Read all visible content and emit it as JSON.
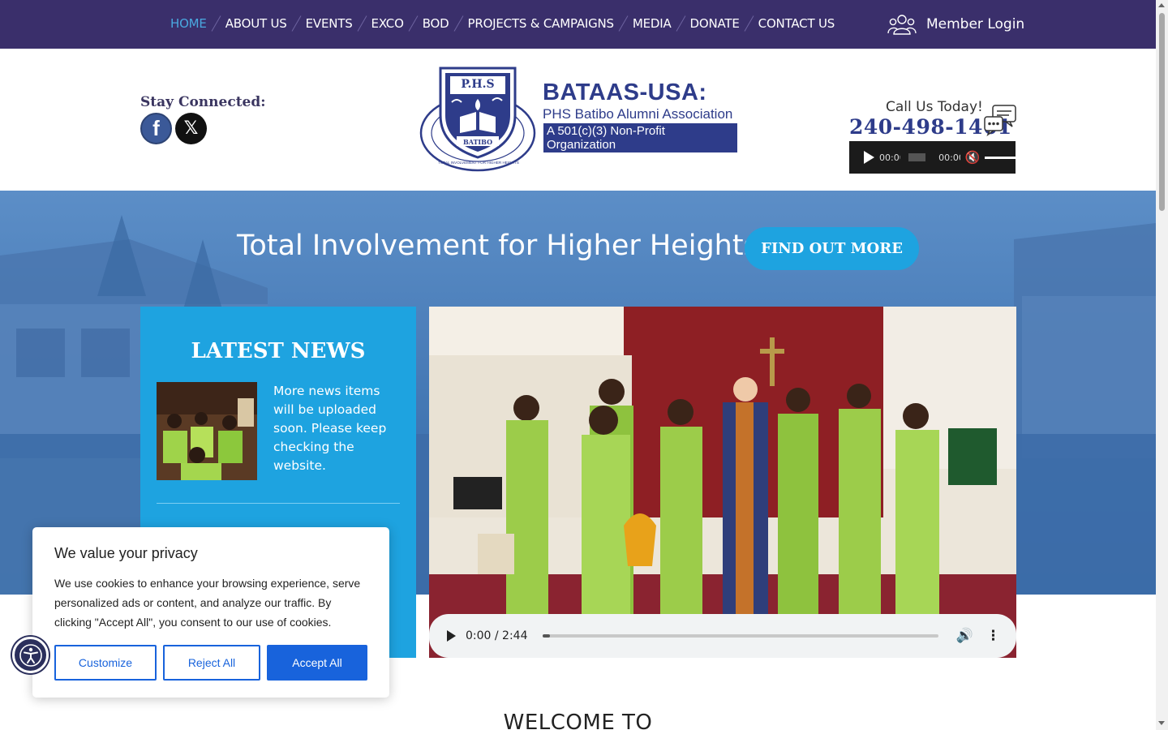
{
  "nav": {
    "items": [
      {
        "label": "HOME",
        "active": true
      },
      {
        "label": "ABOUT US"
      },
      {
        "label": "EVENTS"
      },
      {
        "label": "EXCO"
      },
      {
        "label": "BOD"
      },
      {
        "label": "PROJECTS & CAMPAIGNS"
      },
      {
        "label": "MEDIA"
      },
      {
        "label": "DONATE"
      },
      {
        "label": "CONTACT US"
      }
    ],
    "member_login": "Member Login",
    "member_icon": "users-icon"
  },
  "header": {
    "stay_connected": "Stay Connected:",
    "social": [
      {
        "name": "facebook-icon",
        "glyph": "f"
      },
      {
        "name": "x-icon",
        "glyph": "𝕏"
      }
    ],
    "logo": {
      "seal_top": "P.H.S",
      "seal_bottom": "BATIBO",
      "seal_motto": "TOTAL INVOLVEMENT FOR HIGHER HEIGHTS",
      "title": "BATAAS-USA:",
      "subtitle": "PHS Batibo Alumni Association",
      "badge": "A 501(c)(3) Non-Profit Organization"
    },
    "call_label": "Call Us Today!",
    "phone": "240-498-1461",
    "audio": {
      "current": "00:00",
      "duration": "00:00"
    }
  },
  "hero": {
    "headline": "Total Involvement for Higher Heights",
    "cta": "FIND OUT MORE"
  },
  "news": {
    "title": "LATEST NEWS",
    "item_text": "More news items will be uploaded soon. Please keep checking the website."
  },
  "video": {
    "time": "0:00 / 2:44",
    "progress": 0.02
  },
  "welcome": "WELCOME TO",
  "cookie": {
    "title": "We value your privacy",
    "text": "We use cookies to enhance your browsing experience, serve personalized ads or content, and analyze our traffic. By clicking \"Accept All\", you consent to our use of cookies.",
    "customize": "Customize",
    "reject": "Reject All",
    "accept": "Accept All"
  },
  "colors": {
    "nav_bg": "#3a2f6b",
    "accent": "#1ea3e0",
    "brand": "#2e3c8a",
    "cookie_btn": "#1863dc"
  }
}
